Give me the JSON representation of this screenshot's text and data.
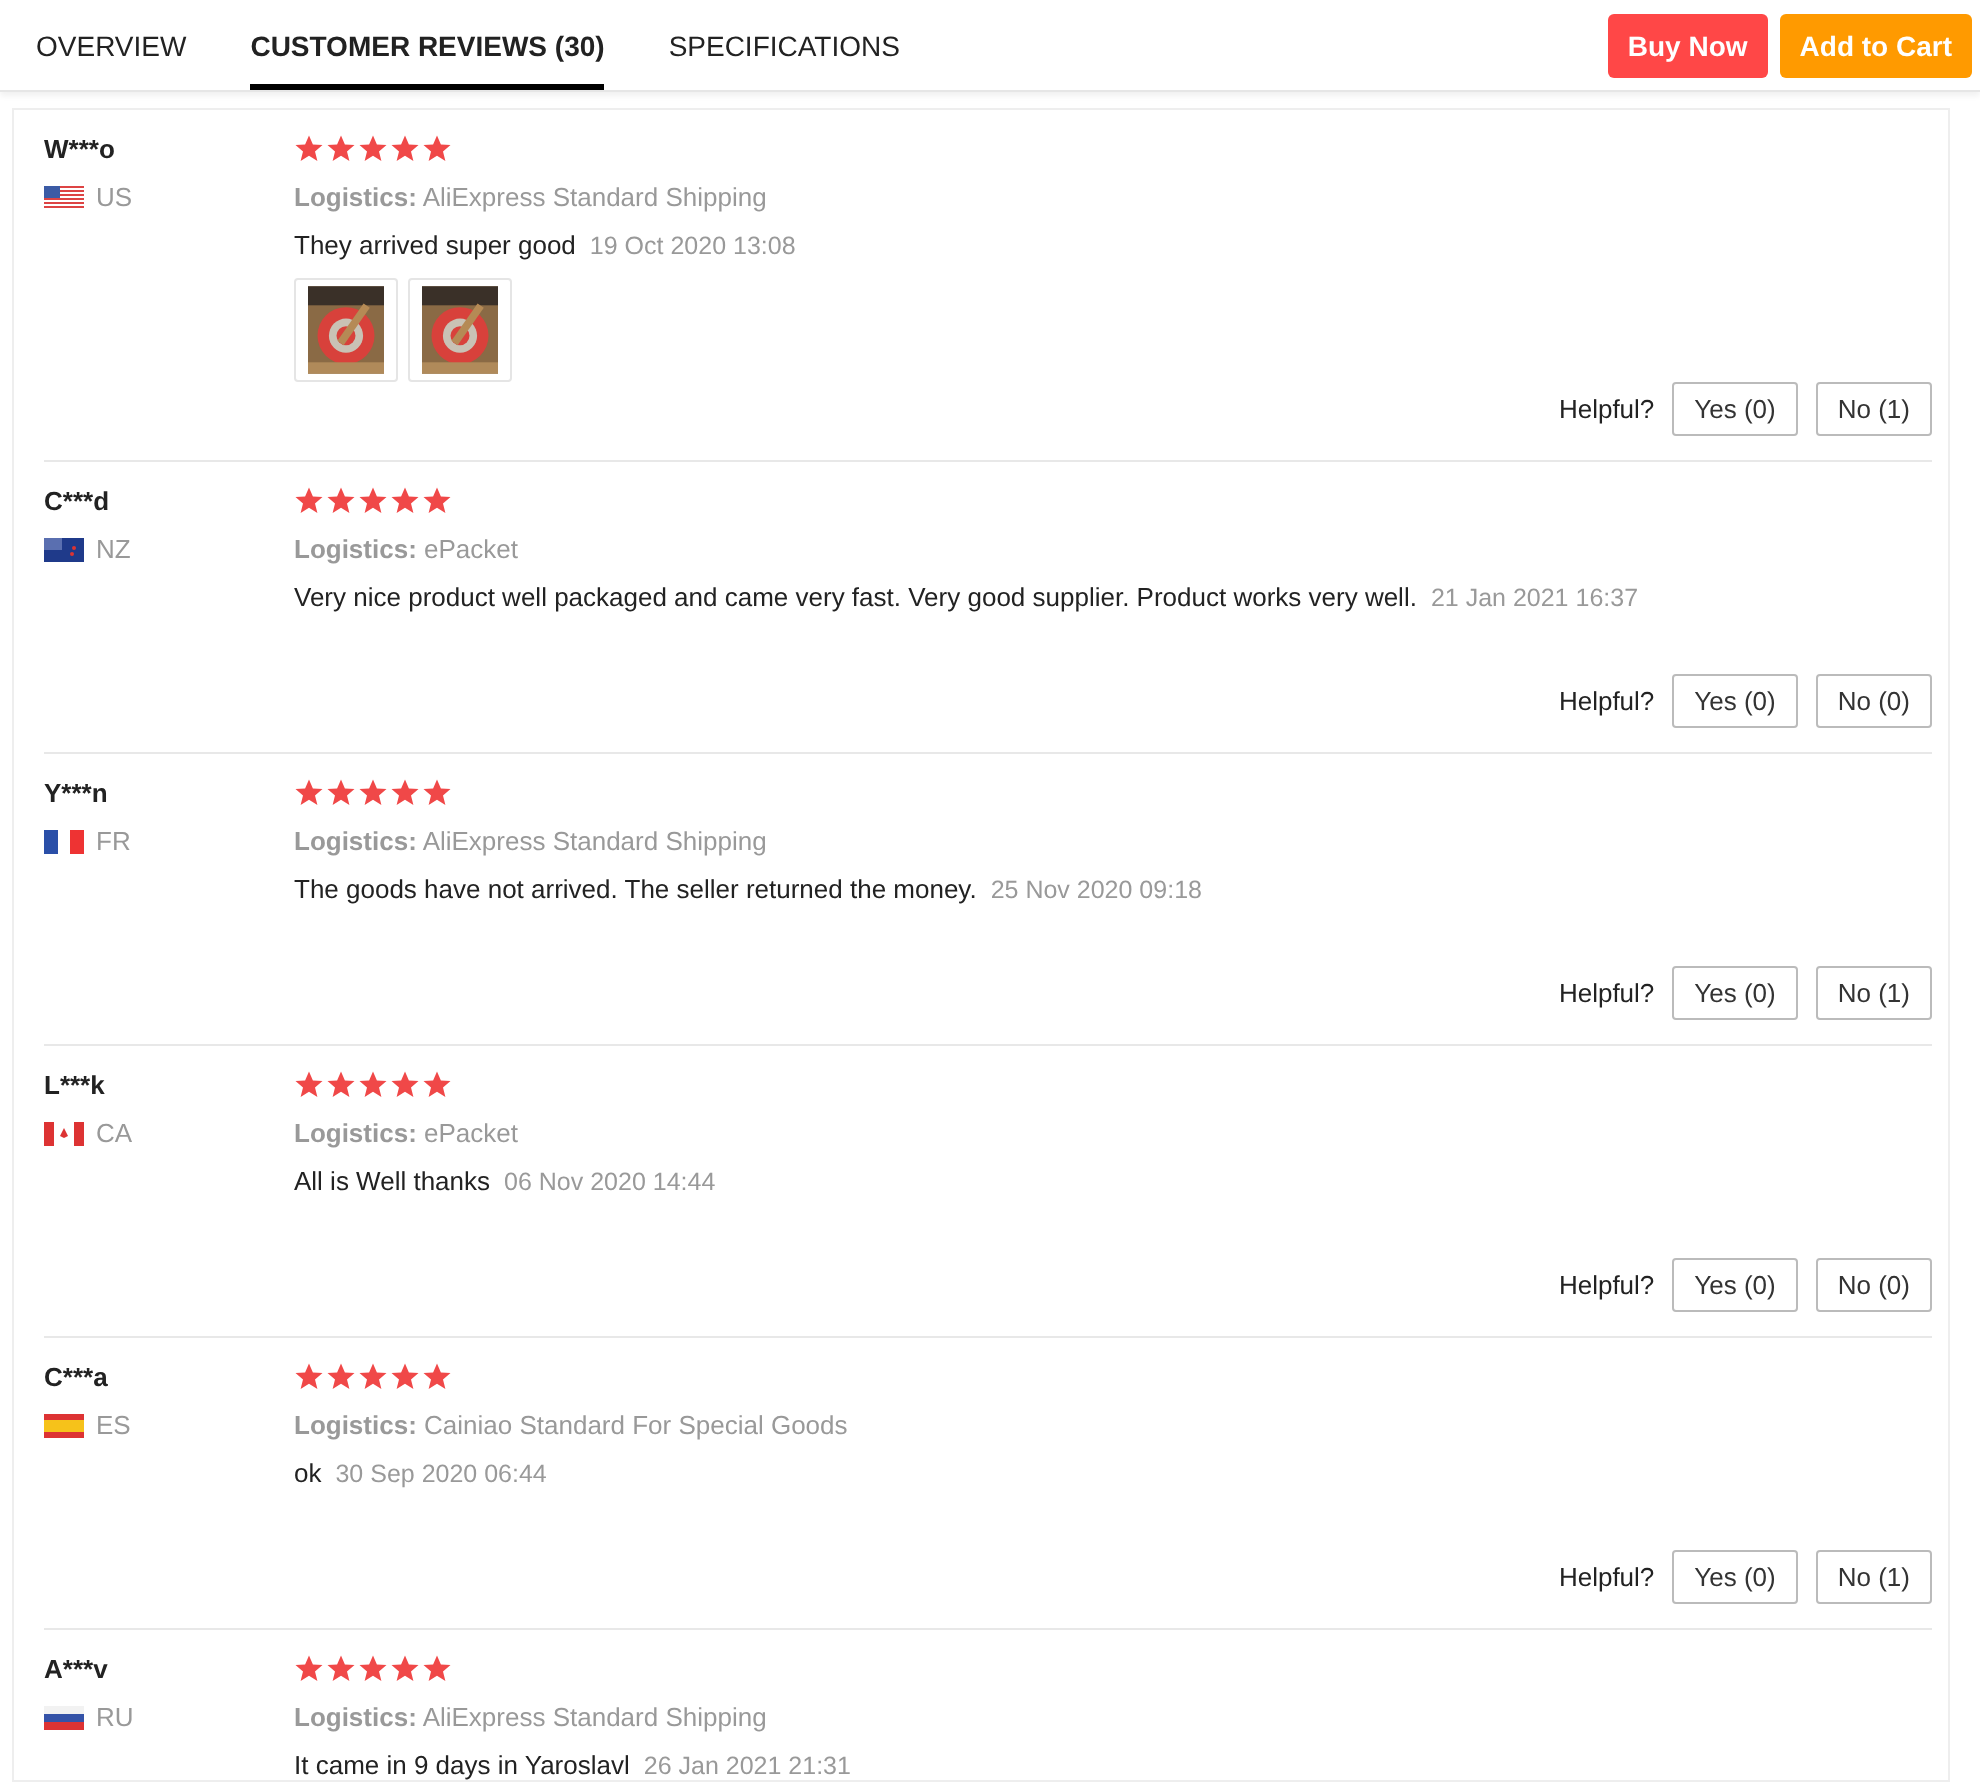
{
  "tabs": [
    {
      "label": "OVERVIEW",
      "selected": false
    },
    {
      "label": "CUSTOMER REVIEWS (30)",
      "selected": true
    },
    {
      "label": "SPECIFICATIONS",
      "selected": false
    }
  ],
  "actions": [
    {
      "label": "Buy Now",
      "kind": "buy"
    },
    {
      "label": "Add to Cart",
      "kind": "cart"
    }
  ],
  "reviews": [
    {
      "user": "W***o",
      "flag": {
        "kind": "us"
      },
      "country": "US",
      "stars": 5,
      "logistics_label": "Logistics:",
      "logistics": "AliExpress Standard Shipping",
      "text": "They arrived super good",
      "date": "19 Oct 2020 13:08",
      "photos": [
        {
          "kind": "picture"
        },
        {
          "kind": "picture"
        }
      ],
      "helpful": {
        "label": "Helpful?",
        "yes": "Yes (0)",
        "no": "No (1)"
      }
    },
    {
      "user": "C***d",
      "flag": {
        "kind": "nz"
      },
      "country": "NZ",
      "stars": 5,
      "logistics_label": "Logistics:",
      "logistics": "ePacket",
      "text": "Very nice product well packaged and came very fast. Very good supplier. Product works very well.",
      "date": "21 Jan 2021 16:37",
      "helpful": {
        "label": "Helpful?",
        "yes": "Yes (0)",
        "no": "No (0)"
      }
    },
    {
      "user": "Y***n",
      "flag": {
        "kind": "fr"
      },
      "country": "FR",
      "stars": 5,
      "logistics_label": "Logistics:",
      "logistics": "AliExpress Standard Shipping",
      "text": "The goods have not arrived. The seller returned the money.",
      "date": "25 Nov 2020 09:18",
      "helpful": {
        "label": "Helpful?",
        "yes": "Yes (0)",
        "no": "No (1)"
      }
    },
    {
      "user": "L***k",
      "flag": {
        "kind": "ca"
      },
      "country": "CA",
      "stars": 5,
      "logistics_label": "Logistics:",
      "logistics": "ePacket",
      "text": "All is Well thanks",
      "date": "06 Nov 2020 14:44",
      "helpful": {
        "label": "Helpful?",
        "yes": "Yes (0)",
        "no": "No (0)"
      }
    },
    {
      "user": "C***a",
      "flag": {
        "kind": "es"
      },
      "country": "ES",
      "stars": 5,
      "logistics_label": "Logistics:",
      "logistics": "Cainiao Standard For Special Goods",
      "text": "ok",
      "date": "30 Sep 2020 06:44",
      "helpful": {
        "label": "Helpful?",
        "yes": "Yes (0)",
        "no": "No (1)"
      }
    },
    {
      "user": "A***v",
      "flag": {
        "kind": "ru"
      },
      "country": "RU",
      "stars": 5,
      "logistics_label": "Logistics:",
      "logistics": "AliExpress Standard Shipping",
      "text": "It came in 9 days in Yaroslavl",
      "date": "26 Jan 2021 21:31"
    }
  ]
}
